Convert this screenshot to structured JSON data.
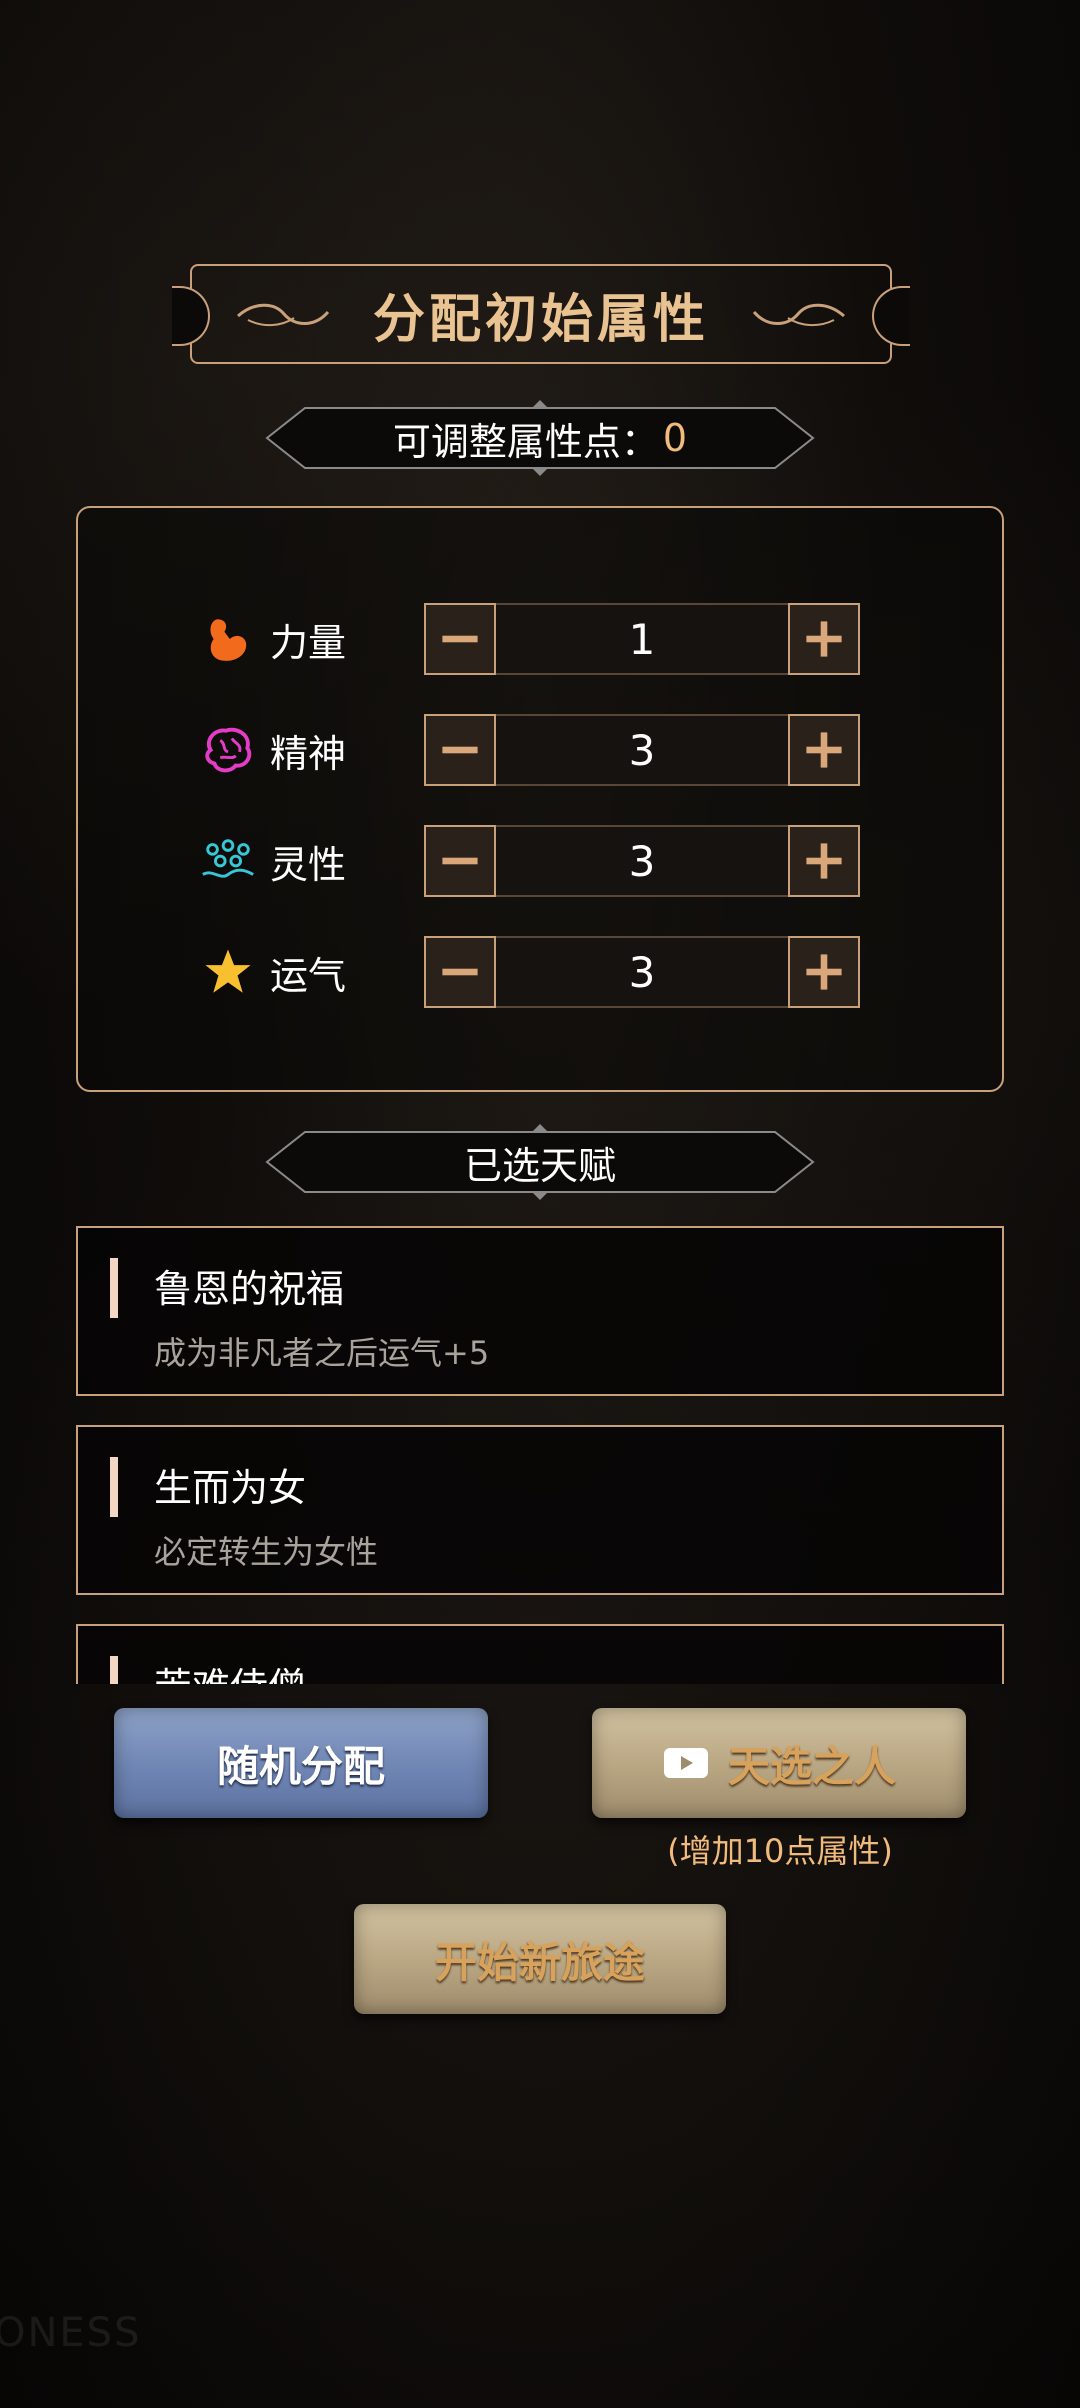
{
  "header": {
    "title": "分配初始属性"
  },
  "points": {
    "label": "可调整属性点：",
    "value": "0"
  },
  "attributes": [
    {
      "name": "力量",
      "value": "1",
      "icon": "muscle-icon",
      "color": "#f26a1b"
    },
    {
      "name": "精神",
      "value": "3",
      "icon": "brain-icon",
      "color": "#e53cc8"
    },
    {
      "name": "灵性",
      "value": "3",
      "icon": "dots-icon",
      "color": "#37c7d6"
    },
    {
      "name": "运气",
      "value": "3",
      "icon": "star-icon",
      "color": "#f8c030"
    }
  ],
  "talents_header": {
    "label": "已选天赋"
  },
  "talents": [
    {
      "title": "鲁恩的祝福",
      "desc": "成为非凡者之后运气+5"
    },
    {
      "title": "生而为女",
      "desc": "必定转生为女性"
    },
    {
      "title": "苦难侍僧",
      "desc": ""
    }
  ],
  "buttons": {
    "random": "随机分配",
    "chosen": "天选之人",
    "chosen_note": "(增加10点属性)",
    "start": "开始新旅途"
  },
  "watermark": "ONESS",
  "colors": {
    "accent_gold": "#c8a07a",
    "value_orange": "#f0bb7c"
  }
}
